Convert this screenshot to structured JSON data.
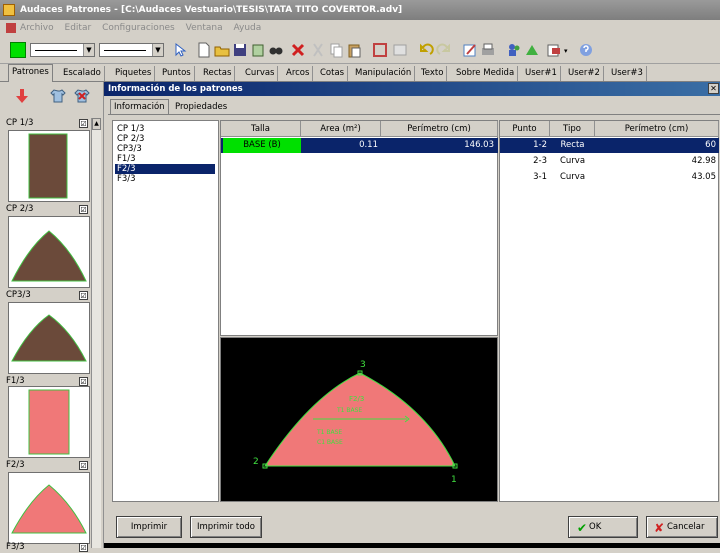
{
  "titlebar": {
    "title": "Audaces Patrones - [C:\\Audaces Vestuario\\TESIS\\TATA TITO COVERTOR.adv]"
  },
  "menu": {
    "items": [
      "Archivo",
      "Editar",
      "Configuraciones",
      "Ventana",
      "Ayuda"
    ]
  },
  "tabs": [
    "Patrones",
    "Escalado",
    "Piquetes",
    "Puntos",
    "Rectas",
    "Curvas",
    "Arcos",
    "Cotas",
    "Manipulación",
    "Texto",
    "Sobre Medida",
    "User#1",
    "User#2",
    "User#3"
  ],
  "sidebar": {
    "cards": [
      {
        "label": "CP 1/3",
        "checked": "☑"
      },
      {
        "label": "CP 2/3",
        "checked": "☑"
      },
      {
        "label": "CP3/3",
        "checked": "☑"
      },
      {
        "label": "F1/3",
        "checked": "☑"
      },
      {
        "label": "F2/3",
        "checked": "☑"
      },
      {
        "label": "F3/3",
        "checked": "☑"
      }
    ]
  },
  "dialog": {
    "title": "Información de los patrones",
    "tabs": [
      "Información",
      "Propiedades"
    ],
    "pattern_list": [
      "CP 1/3",
      "CP 2/3",
      "CP3/3",
      "F1/3",
      "F2/3",
      "F3/3"
    ],
    "selected_pattern": "F2/3",
    "sizes_table": {
      "headers": [
        "Talla",
        "Area (m²)",
        "Perímetro (cm)"
      ],
      "rows": [
        [
          "BASE (B)",
          "0.11",
          "146.03"
        ]
      ]
    },
    "points_table": {
      "headers": [
        "Punto",
        "Tipo",
        "Perímetro (cm)"
      ],
      "rows": [
        [
          "1-2",
          "Recta",
          "60"
        ],
        [
          "2-3",
          "Curva",
          "42.98"
        ],
        [
          "3-1",
          "Curva",
          "43.05"
        ]
      ]
    },
    "preview": {
      "point_labels": [
        "3",
        "2",
        "1"
      ],
      "piece_text_1": "F2/3",
      "piece_text_2": "T1 BASE",
      "piece_text_3": "T1 BASE",
      "piece_text_4": "C1 BASE"
    },
    "buttons": {
      "print": "Imprimir",
      "print_all": "Imprimir todo",
      "ok": "OK",
      "cancel": "Cancelar"
    }
  },
  "colors": {
    "base_row": "#00e000",
    "piece_fill": "#f07878",
    "thumb_brown": "#6b4a3a",
    "preview_bg": "#000000",
    "selection": "#0a246a"
  }
}
